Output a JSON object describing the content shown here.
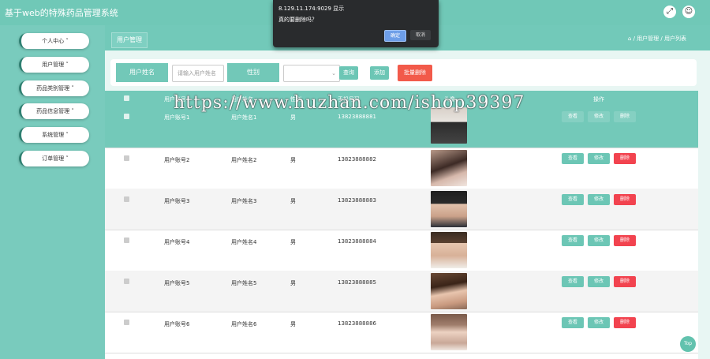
{
  "app": {
    "title": "基于web的特殊药品管理系统"
  },
  "topbar": {
    "icons": [
      "expand-icon",
      "user-icon"
    ]
  },
  "sidebar": {
    "items": [
      {
        "label": "个人中心"
      },
      {
        "label": "用户管理"
      },
      {
        "label": "药品类别管理"
      },
      {
        "label": "药品信息管理"
      },
      {
        "label": "系统管理"
      },
      {
        "label": "订单管理"
      }
    ]
  },
  "breadcrumb": {
    "tab": "用户管理",
    "path": "/ 用户管理 / 用户列表"
  },
  "search": {
    "username_label": "用户姓名",
    "username_placeholder": "请输入用户姓名",
    "gender_label": "性别",
    "query_button": "查询",
    "add_button": "添加",
    "batch_delete_button": "批量删除"
  },
  "table": {
    "headers": [
      "用户账号",
      "用户姓名",
      "性别",
      "手机号码",
      "头像",
      "操作"
    ],
    "rows": [
      {
        "account": "用户账号1",
        "name": "用户姓名1",
        "gender": "男",
        "phone": "13823888881"
      },
      {
        "account": "用户账号2",
        "name": "用户姓名2",
        "gender": "男",
        "phone": "13823888882"
      },
      {
        "account": "用户账号3",
        "name": "用户姓名3",
        "gender": "男",
        "phone": "13823888883"
      },
      {
        "account": "用户账号4",
        "name": "用户姓名4",
        "gender": "男",
        "phone": "13823888884"
      },
      {
        "account": "用户账号5",
        "name": "用户姓名5",
        "gender": "男",
        "phone": "13823888885"
      },
      {
        "account": "用户账号6",
        "name": "用户姓名6",
        "gender": "男",
        "phone": "13823888886"
      }
    ],
    "actions": {
      "view": "查看",
      "edit": "修改",
      "delete": "删除"
    }
  },
  "dialog": {
    "origin": "8.129.11.174:9029 显示",
    "message": "真的要删除吗？",
    "confirm": "确定",
    "cancel": "取消"
  },
  "watermark": "https://www.huzhan.com/ishop39397",
  "top_button": "Top",
  "colors": {
    "teal": "#72c9b9",
    "delete_red": "#f2434f",
    "query_teal": "#6cc6b5",
    "batch_delete": "#f25a4a"
  }
}
